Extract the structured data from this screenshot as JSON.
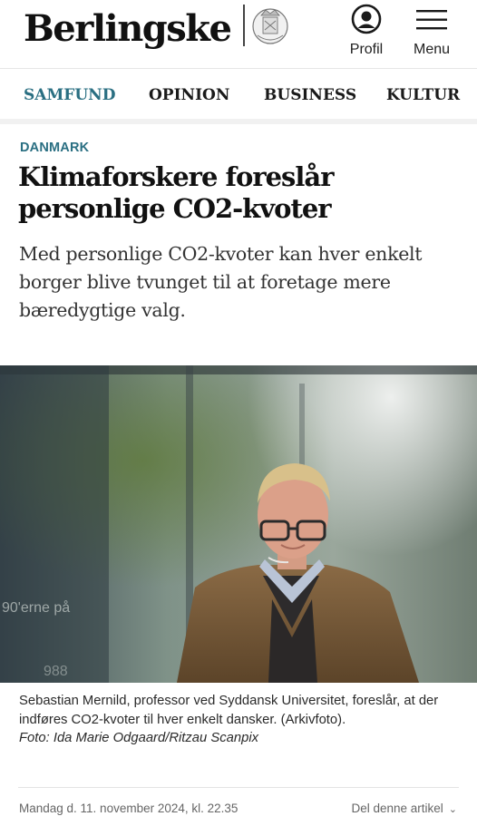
{
  "header": {
    "logo_text": "Berlingske",
    "profile_label": "Profil",
    "menu_label": "Menu"
  },
  "nav": {
    "items": [
      {
        "label": "SAMFUND",
        "active": true
      },
      {
        "label": "OPINION",
        "active": false
      },
      {
        "label": "BUSINESS",
        "active": false
      },
      {
        "label": "KULTUR",
        "active": false
      }
    ]
  },
  "article": {
    "kicker": "DANMARK",
    "headline_line1": "Klimaforskere foreslår",
    "headline_line2": "personlige CO2-kvoter",
    "lede": "Med personlige CO2-kvoter kan hver enkelt borger blive tvunget til at foretage mere bæredygtige valg.",
    "caption": "Sebastian Mernild, professor ved Syddansk Universitet, foreslår, at der indføres CO2-kvoter til hver enkelt dansker. (Arkivfoto).",
    "credit": "Foto: Ida Marie Odgaard/Ritzau Scanpix",
    "photo_text_1": "90'erne på",
    "photo_text_2": "988",
    "dateline": "Mandag d. 11. november 2024, kl. 22.35",
    "share_label": "Del denne artikel"
  },
  "colors": {
    "accent": "#2a6f82",
    "text": "#111111",
    "muted": "#666666"
  },
  "icons": {
    "profile": "user-circle-icon",
    "menu": "hamburger-icon",
    "crest": "royal-crest-icon",
    "share_chevron": "chevron-down-icon"
  }
}
